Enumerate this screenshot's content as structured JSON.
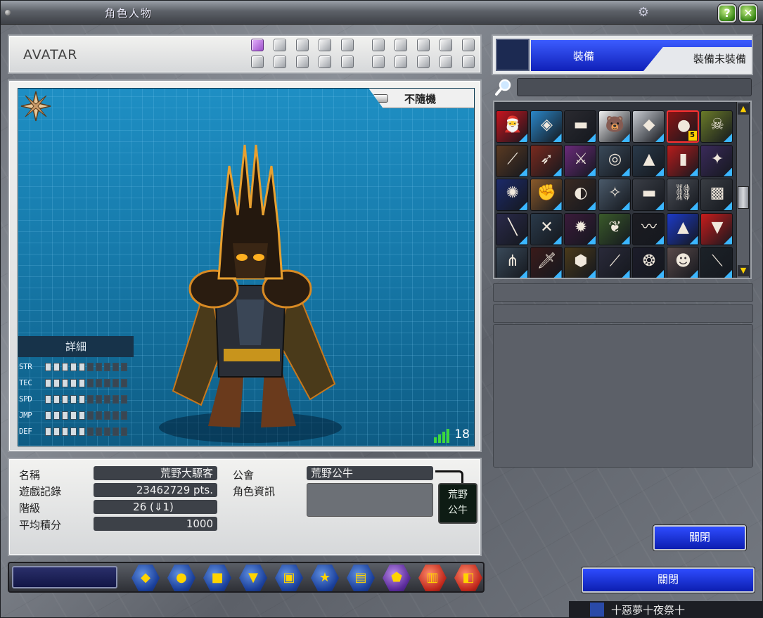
{
  "window": {
    "title": "角色人物"
  },
  "avatar": {
    "label": "AVATAR",
    "slots_row1": [
      true,
      false,
      false,
      false,
      false,
      false,
      false,
      false,
      false,
      false
    ],
    "slots_row2": [
      false,
      false,
      false,
      false,
      false,
      false,
      false,
      false,
      false,
      false
    ]
  },
  "viewer": {
    "random_label": "不隨機",
    "detail_label": "詳細",
    "stats": [
      {
        "name": "STR",
        "level": 5,
        "max": 10
      },
      {
        "name": "TEC",
        "level": 5,
        "max": 10
      },
      {
        "name": "SPD",
        "level": 5,
        "max": 10
      },
      {
        "name": "JMP",
        "level": 5,
        "max": 10
      },
      {
        "name": "DEF",
        "level": 5,
        "max": 10
      }
    ],
    "signal_value": "18"
  },
  "info": {
    "name_label": "名稱",
    "name_value": "荒野大驃客",
    "record_label": "遊戲記錄",
    "record_value": "23462729 pts.",
    "rank_label": "階級",
    "rank_value": "26 (⇓1)",
    "avg_label": "平均積分",
    "avg_value": "1000",
    "guild_label": "公會",
    "guild_value": "荒野公牛",
    "role_label": "角色資訊",
    "emblem_text": "荒野公牛"
  },
  "equipment": {
    "tab_equipped": "裝備",
    "tab_unequipped": "裝備未裝備",
    "search_placeholder": "",
    "selected_badge": "5",
    "items": [
      {
        "icon": "santa-hat",
        "glyph": "🎅",
        "bg": "#c8141e"
      },
      {
        "icon": "blue-gadget",
        "glyph": "◈",
        "bg": "#2a86c8"
      },
      {
        "icon": "gun-black",
        "glyph": "▬",
        "bg": "#2a2a30"
      },
      {
        "icon": "white-bear",
        "glyph": "🐻",
        "bg": "#f0f0f0"
      },
      {
        "icon": "silver-armor",
        "glyph": "◆",
        "bg": "#c8ccd2"
      },
      {
        "icon": "red-orb",
        "glyph": "●",
        "bg": "#8a1414"
      },
      {
        "icon": "skull-mask",
        "glyph": "☠",
        "bg": "#6a7a28"
      },
      {
        "icon": "bronze-claw",
        "glyph": "⟋",
        "bg": "#5a3a22"
      },
      {
        "icon": "red-horn",
        "glyph": "➶",
        "bg": "#7a2a1e"
      },
      {
        "icon": "purple-blade",
        "glyph": "⚔",
        "bg": "#6a2a7a"
      },
      {
        "icon": "steel-ring",
        "glyph": "◎",
        "bg": "#3a4a5a"
      },
      {
        "icon": "spike-arrow",
        "glyph": "▲",
        "bg": "#2a3a4a"
      },
      {
        "icon": "red-canister",
        "glyph": "▮",
        "bg": "#b81c1c"
      },
      {
        "icon": "dark-wing",
        "glyph": "✦",
        "bg": "#3a2a5a"
      },
      {
        "icon": "blue-orb-gun",
        "glyph": "✺",
        "bg": "#1c2a6a"
      },
      {
        "icon": "bronze-fist",
        "glyph": "✊",
        "bg": "#8a5a2a"
      },
      {
        "icon": "dark-disc",
        "glyph": "◐",
        "bg": "#3a2a22"
      },
      {
        "icon": "robot-parts",
        "glyph": "✧",
        "bg": "#4a5a6a"
      },
      {
        "icon": "gun-barrel",
        "glyph": "▬",
        "bg": "#3a3e46"
      },
      {
        "icon": "chain-link",
        "glyph": "⛓",
        "bg": "#4a4e56"
      },
      {
        "icon": "gray-armor",
        "glyph": "▩",
        "bg": "#3a3e44"
      },
      {
        "icon": "purple-staff",
        "glyph": "╲",
        "bg": "#2a2a4a"
      },
      {
        "icon": "silver-wings",
        "glyph": "✕",
        "bg": "#2a3a4a"
      },
      {
        "icon": "pink-gem",
        "glyph": "✹",
        "bg": "#3a1a3a"
      },
      {
        "icon": "green-cape",
        "glyph": "❦",
        "bg": "#3a5a2a"
      },
      {
        "icon": "black-whip",
        "glyph": "〰",
        "bg": "#1c1c22"
      },
      {
        "icon": "blue-hat",
        "glyph": "▲",
        "bg": "#1c3ac8"
      },
      {
        "icon": "red-skirt",
        "glyph": "▼",
        "bg": "#c81c1c"
      },
      {
        "icon": "spike-claws",
        "glyph": "⋔",
        "bg": "#3a4a5a"
      },
      {
        "icon": "flame-sword",
        "glyph": "🗡",
        "bg": "#3a1a1a"
      },
      {
        "icon": "gold-plate",
        "glyph": "⬢",
        "bg": "#4a3a1a"
      },
      {
        "icon": "dark-staff",
        "glyph": "⟋",
        "bg": "#2a2a3a"
      },
      {
        "icon": "shadow-ring",
        "glyph": "❂",
        "bg": "#1c1c2a"
      },
      {
        "icon": "bone-mask",
        "glyph": "☻",
        "bg": "#5a4a4a"
      },
      {
        "icon": "black-rifle",
        "glyph": "⟍",
        "bg": "#1c2228"
      }
    ]
  },
  "buttons": {
    "close_inner": "關閉",
    "close_outer": "關閉"
  },
  "toolbar_icons": [
    {
      "name": "cube-icon",
      "glyph": "◆",
      "variant": ""
    },
    {
      "name": "chat-icon",
      "glyph": "●",
      "variant": ""
    },
    {
      "name": "box-icon",
      "glyph": "■",
      "variant": ""
    },
    {
      "name": "shield-icon",
      "glyph": "▼",
      "variant": ""
    },
    {
      "name": "bag-icon",
      "glyph": "▣",
      "variant": ""
    },
    {
      "name": "star-icon",
      "glyph": "★",
      "variant": ""
    },
    {
      "name": "cards-icon",
      "glyph": "▤",
      "variant": ""
    },
    {
      "name": "helmet-icon",
      "glyph": "⬟",
      "variant": "purple"
    },
    {
      "name": "ranking-icon",
      "glyph": "▥",
      "variant": "red"
    },
    {
      "name": "exit-icon",
      "glyph": "◧",
      "variant": "red"
    }
  ],
  "taskbar": {
    "text": "十惡夢十夜祭十"
  }
}
